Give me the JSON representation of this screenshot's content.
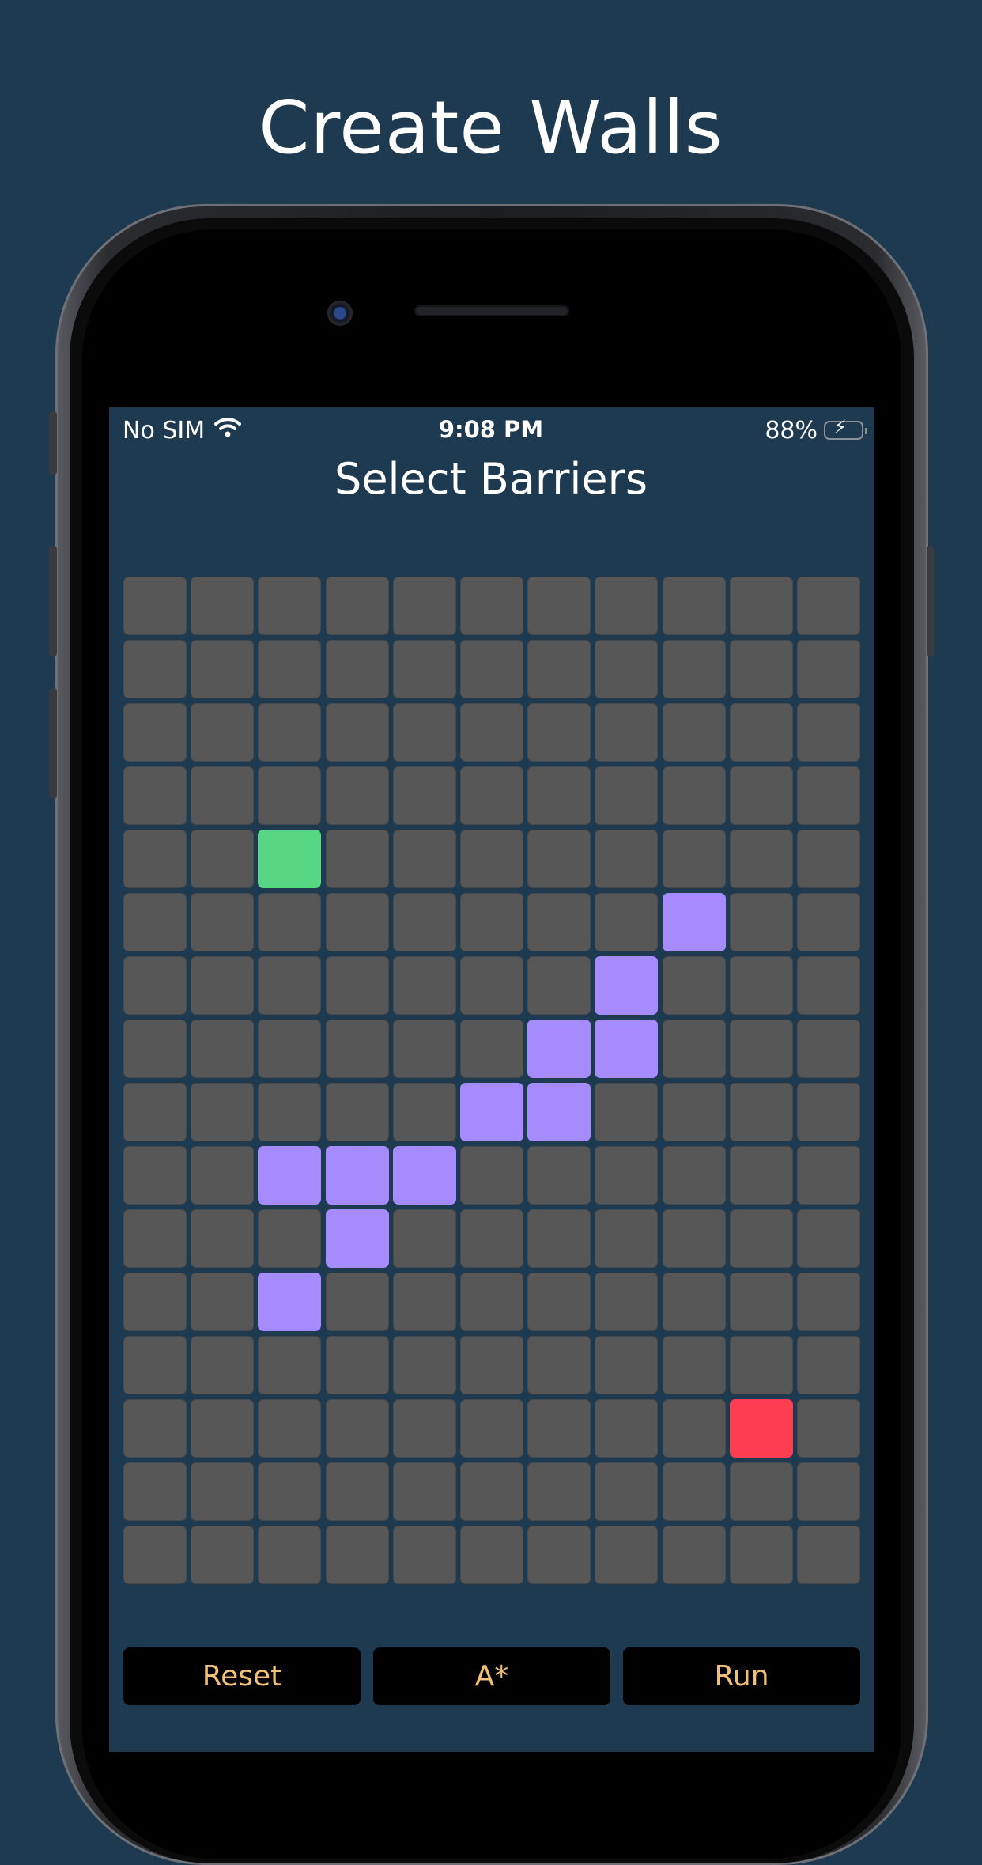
{
  "headline": "Create Walls",
  "status_bar": {
    "carrier": "No SIM",
    "time": "9:08 PM",
    "battery_percent": "88%",
    "battery_level": 0.88,
    "wifi_icon": "wifi-icon",
    "battery_icon": "battery-charging-icon"
  },
  "screen_title": "Select Barriers",
  "grid": {
    "columns": 11,
    "rows": 16,
    "start": [
      4,
      2
    ],
    "end": [
      13,
      9
    ],
    "walls": [
      [
        5,
        8
      ],
      [
        6,
        7
      ],
      [
        7,
        6
      ],
      [
        7,
        7
      ],
      [
        8,
        5
      ],
      [
        8,
        6
      ],
      [
        9,
        2
      ],
      [
        9,
        3
      ],
      [
        9,
        4
      ],
      [
        10,
        3
      ],
      [
        11,
        2
      ]
    ],
    "colors": {
      "empty": "#575757",
      "start": "#57d683",
      "end": "#fd3d52",
      "wall": "#a58bfb"
    }
  },
  "buttons": {
    "reset": "Reset",
    "algorithm": "A*",
    "run": "Run",
    "text_color": "#f2c177"
  },
  "colors": {
    "background": "#1e3a51"
  }
}
